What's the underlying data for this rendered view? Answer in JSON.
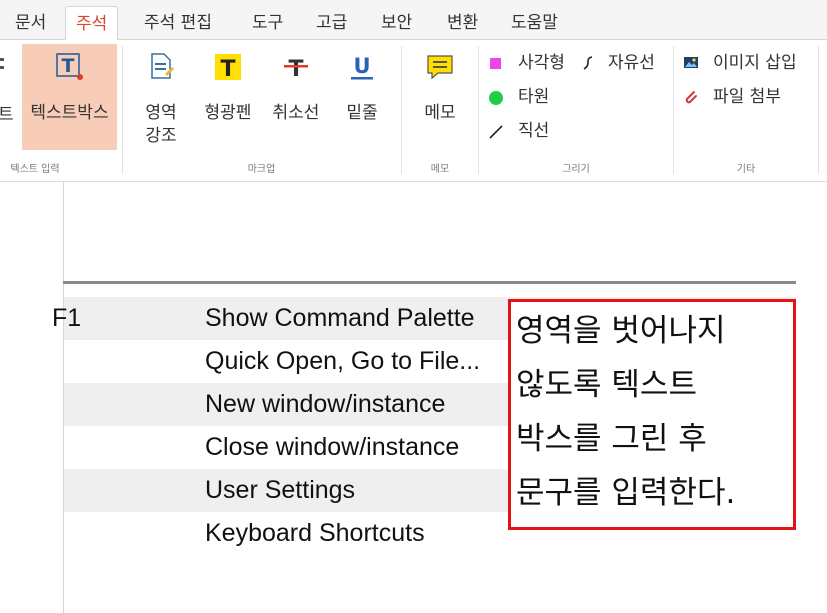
{
  "tabs": [
    {
      "label": "문서"
    },
    {
      "label": "주석",
      "active": true
    },
    {
      "label": "주석 편집"
    },
    {
      "label": "도구"
    },
    {
      "label": "고급"
    },
    {
      "label": "보안"
    },
    {
      "label": "변환"
    },
    {
      "label": "도움말"
    }
  ],
  "ribbon": {
    "text_input": {
      "clipped_label": "트",
      "textbox_label": "텍스트박스",
      "group_label": "텍스트 입력"
    },
    "markup": {
      "area_highlight_label": "영역\n강조",
      "highlighter_label": "형광펜",
      "strikethrough_label": "취소선",
      "underline_label": "밑줄",
      "group_label": "마크업"
    },
    "memo": {
      "memo_label": "메모",
      "group_label": "메모"
    },
    "draw": {
      "rectangle_label": "사각형",
      "freeform_label": "자유선",
      "ellipse_label": "타원",
      "line_label": "직선",
      "group_label": "그리기"
    },
    "other": {
      "insert_image_label": "이미지 삽입",
      "attach_file_label": "파일 첨부",
      "group_label": "기타"
    }
  },
  "document": {
    "rows": [
      {
        "key": "F1",
        "command": "Show Command Palette",
        "shaded": true
      },
      {
        "key": "",
        "command": "Quick Open, Go to File...",
        "shaded": false
      },
      {
        "key": "",
        "command": "New window/instance",
        "shaded": true
      },
      {
        "key": "",
        "command": "Close window/instance",
        "shaded": false
      },
      {
        "key": "",
        "command": "User Settings",
        "shaded": true
      },
      {
        "key": "",
        "command": "Keyboard Shortcuts",
        "shaded": false
      }
    ],
    "textbox_text": "영역을 벗어나지 않도록 텍스트 박스를 그린 후 문구를 입력한다."
  },
  "colors": {
    "active_tab_text": "#d9462f",
    "active_button_bg": "#f7cdb8",
    "textbox_border": "#e41414",
    "rectangle_swatch": "#ee44ee",
    "ellipse_swatch": "#22cc44"
  }
}
